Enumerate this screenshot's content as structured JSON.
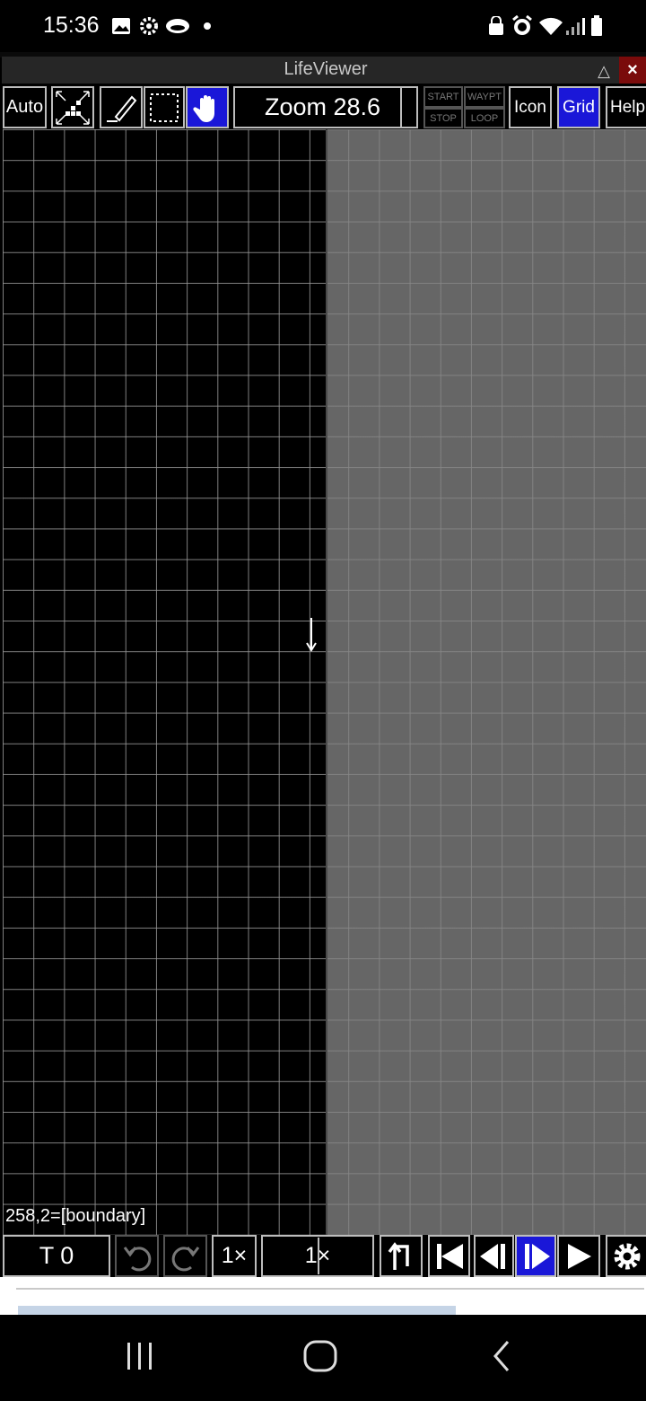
{
  "status_bar": {
    "time": "15:36",
    "icons_left": [
      "image-icon",
      "gear-icon",
      "cloud-icon",
      "dot-icon"
    ],
    "icons_right": [
      "lock-icon",
      "alarm-icon",
      "wifi-icon",
      "signal-icon",
      "battery-icon"
    ]
  },
  "window": {
    "title": "LifeViewer",
    "collapse_label": "△",
    "close_label": "×"
  },
  "toolbar": {
    "auto_label": "Auto",
    "zoom_label": "Zoom 28.6",
    "start_label": "START",
    "waypt_label": "WAYPT",
    "stop_label": "STOP",
    "loop_label": "LOOP",
    "icon_label": "Icon",
    "grid_label": "Grid",
    "help_label": "Help"
  },
  "canvas": {
    "coordinates": "258,2=[boundary]",
    "colors": {
      "alive_bg": "#000000",
      "dead_bg": "#666666",
      "grid": "#969696"
    }
  },
  "controls": {
    "generation_label": "T 0",
    "step_label": "1×",
    "speed_label": "1×"
  },
  "colors": {
    "selected": "#1a17d8",
    "close": "#7a0b0b"
  }
}
